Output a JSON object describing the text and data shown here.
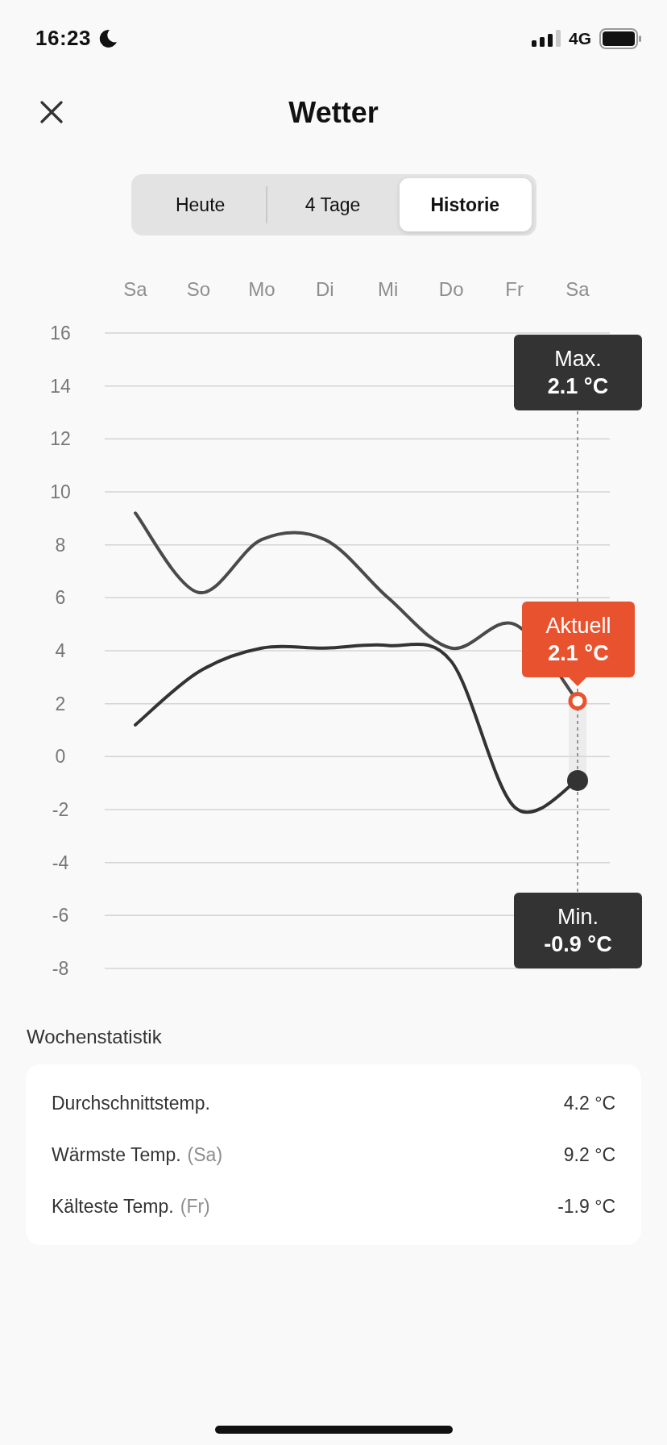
{
  "status_bar": {
    "time": "16:23",
    "network": "4G"
  },
  "header": {
    "title": "Wetter"
  },
  "tabs": [
    {
      "label": "Heute",
      "selected": false
    },
    {
      "label": "4 Tage",
      "selected": false
    },
    {
      "label": "Historie",
      "selected": true
    }
  ],
  "chart": {
    "chart_data": {
      "type": "line",
      "categories": [
        "Sa",
        "So",
        "Mo",
        "Di",
        "Mi",
        "Do",
        "Fr",
        "Sa"
      ],
      "ylim": [
        -8,
        16
      ],
      "grid": true,
      "yticks": [
        16,
        14,
        12,
        10,
        8,
        6,
        4,
        2,
        0,
        -2,
        -4,
        -6,
        -8
      ],
      "series": [
        {
          "color": "#4a4a4a",
          "values": [
            9.2,
            6.2,
            8.2,
            8.2,
            6.0,
            4.1,
            5.0,
            2.1
          ]
        },
        {
          "color": "#333333",
          "values": [
            1.2,
            3.2,
            4.1,
            4.1,
            4.2,
            3.6,
            -1.9,
            -0.9
          ]
        }
      ]
    },
    "tooltips": [
      {
        "kind": "max",
        "label": "Max.",
        "value": "2.1 °C"
      },
      {
        "kind": "current",
        "label": "Aktuell",
        "value": "2.1 °C"
      },
      {
        "kind": "min",
        "label": "Min.",
        "value": "-0.9 °C"
      }
    ]
  },
  "statistics": {
    "title": "Wochenstatistik",
    "rows": [
      {
        "label": "Durchschnittstemp.",
        "value": "4.2 °C"
      },
      {
        "label": "Wärmste Temp.",
        "note": "(Sa)",
        "value": "9.2 °C"
      },
      {
        "label": "Kälteste Temp.",
        "note": "(Fr)",
        "value": "-1.9 °C"
      }
    ]
  }
}
